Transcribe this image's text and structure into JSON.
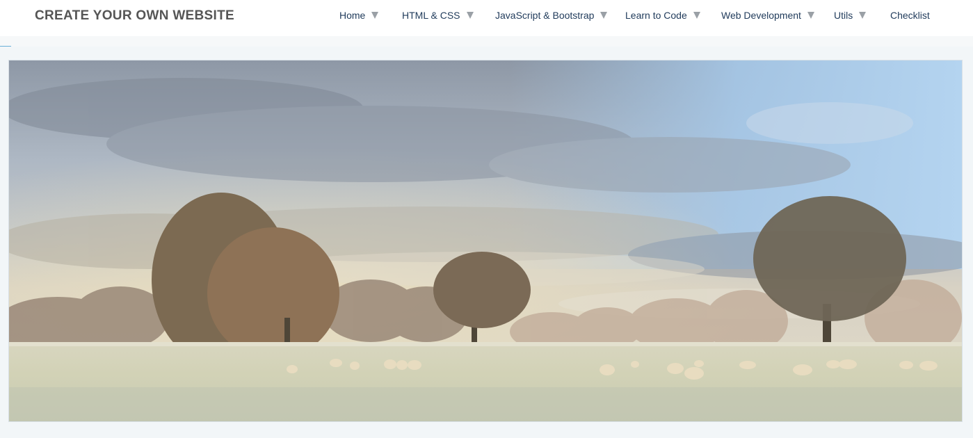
{
  "header": {
    "brand": "CREATE YOUR OWN WEBSITE"
  },
  "nav": {
    "items": [
      {
        "label": "Home",
        "has_dropdown": true
      },
      {
        "label": "HTML & CSS",
        "has_dropdown": true
      },
      {
        "label": "JavaScript & Bootstrap",
        "has_dropdown": true
      },
      {
        "label": "Learn to Code",
        "has_dropdown": true
      },
      {
        "label": "Web Development",
        "has_dropdown": true
      },
      {
        "label": "Utils",
        "has_dropdown": true
      },
      {
        "label": "Checklist",
        "has_dropdown": false
      }
    ]
  },
  "hero": {
    "image": "landscape-photo"
  },
  "colors": {
    "brand_text": "#555555",
    "nav_text": "#1f3a5a",
    "caret": "#9aa0a6",
    "page_bg": "#f2f6f8"
  }
}
